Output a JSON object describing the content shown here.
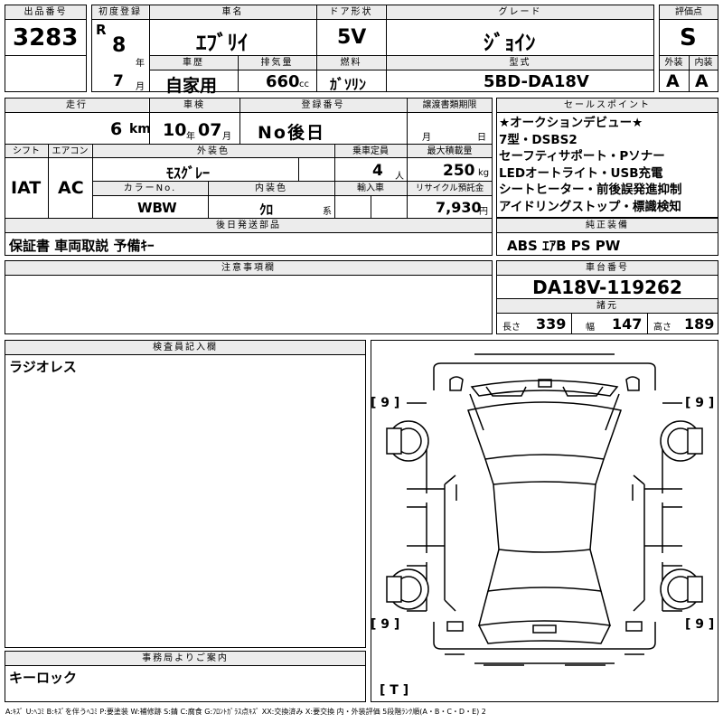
{
  "lot": {
    "header": "出品番号",
    "value": "3283"
  },
  "first_reg": {
    "header": "初度登録",
    "era": "R",
    "year": "8",
    "year_unit": "年",
    "month": "7",
    "month_unit": "月"
  },
  "car_name": {
    "header": "車名",
    "value": "ｴﾌﾞﾘｲ"
  },
  "door": {
    "header": "ドア形状",
    "value": "5V"
  },
  "grade": {
    "header": "グレード",
    "value": "ｼﾞｮｲﾝ"
  },
  "rating": {
    "header": "評価点",
    "value": "S",
    "ext_header": "外装",
    "int_header": "内装",
    "ext": "A",
    "int": "A"
  },
  "history": {
    "header": "車歴",
    "value": "自家用"
  },
  "displacement": {
    "header": "排気量",
    "value": "660",
    "unit": "cc"
  },
  "fuel": {
    "header": "燃料",
    "value": "ｶﾞｿﾘﾝ"
  },
  "model": {
    "header": "型式",
    "value": "5BD-DA18V"
  },
  "mileage": {
    "header": "走行",
    "value": "6",
    "unit": "km"
  },
  "inspection": {
    "header": "車検",
    "year": "10",
    "year_unit": "年",
    "month": "07",
    "month_unit": "月"
  },
  "plate": {
    "header": "登録番号",
    "value": "No後日"
  },
  "transfer": {
    "header": "譲渡書類期限",
    "month_unit": "月",
    "day_unit": "日"
  },
  "shift": {
    "header": "シフト",
    "value": "IAT"
  },
  "ac": {
    "header": "エアコン",
    "value": "AC"
  },
  "ext_color": {
    "header": "外装色",
    "value": "ﾓｽｸﾞﾚｰ"
  },
  "capacity": {
    "header": "乗車定員",
    "value": "4",
    "unit": "人"
  },
  "load": {
    "header": "最大積載量",
    "value": "250",
    "unit": "kg"
  },
  "color_no": {
    "header": "カラーNo.",
    "value": "WBW"
  },
  "int_color": {
    "header": "内装色",
    "value": "ｸﾛ",
    "unit": "系"
  },
  "import": {
    "header": "輸入車"
  },
  "recycle": {
    "header": "リサイクル預託金",
    "value": "7,930",
    "unit": "円"
  },
  "sales_points": {
    "header": "セールスポイント",
    "lines": [
      "★オークションデビュー★",
      "7型・DSBS2",
      "セーフティサポート・Pソナー",
      "LEDオートライト・USB充電",
      "シートヒーター・前後誤発進抑制",
      "アイドリングストップ・標識検知"
    ]
  },
  "later_parts": {
    "header": "後日発送部品",
    "value": "保証書 車両取説 予備ｷｰ"
  },
  "genuine": {
    "header": "純正装備",
    "value": "ABS ｴｱB PS PW"
  },
  "notes": {
    "header": "注意事項欄",
    "value": ""
  },
  "chassis": {
    "header": "車台番号",
    "value": "DA18V-119262"
  },
  "specs": {
    "header": "諸元",
    "length_label": "長さ",
    "length": "339",
    "width_label": "幅",
    "width": "147",
    "height_label": "高さ",
    "height": "189"
  },
  "inspector": {
    "header": "検査員記入欄",
    "value": "ラジオレス"
  },
  "office": {
    "header": "事務局よりご案内",
    "value": "キーロック"
  },
  "diagram": {
    "tire_fl": "9",
    "tire_fr": "9",
    "tire_rl": "9",
    "tire_rr": "9",
    "trunk": "T"
  },
  "legend": "A:ｷｽﾞ U:ﾍｺﾐ B:ｷｽﾞを伴うﾍｺﾐ P:要塗装 W:補修跡 S:錆 C:腐食 G:ﾌﾛﾝﾄｶﾞﾗｽ点ｷｽﾞ XX:交換済み X:要交換 内・外装評価 5段階ﾗﾝｸ順(A・B・C・D・E) 2"
}
